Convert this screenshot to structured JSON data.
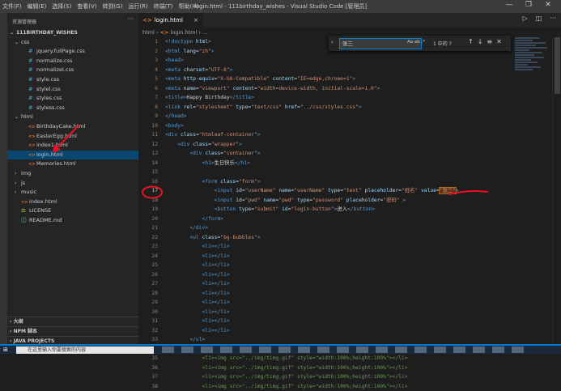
{
  "window": {
    "title": "login.html - 111birthday_wishes - Visual Studio Code [管理员]",
    "menu": [
      "文件(F)",
      "编辑(E)",
      "选择(S)",
      "查看(V)",
      "转到(G)",
      "运行(R)",
      "终端(T)",
      "帮助(H)"
    ],
    "controls": [
      "—",
      "❐",
      "✕"
    ]
  },
  "sidebar": {
    "title": "资源管理器",
    "more": "···",
    "root": "111BIRTHDAY_WISHES",
    "tree": [
      {
        "label": "css",
        "kind": "folder-open",
        "depth": 1
      },
      {
        "label": "jquery.fullPage.css",
        "kind": "css",
        "depth": 2
      },
      {
        "label": "normalize.css",
        "kind": "css",
        "depth": 2
      },
      {
        "label": "normalizel.css",
        "kind": "css",
        "depth": 2
      },
      {
        "label": "style.css",
        "kind": "css",
        "depth": 2
      },
      {
        "label": "stylel.css",
        "kind": "css",
        "depth": 2
      },
      {
        "label": "styles.css",
        "kind": "css",
        "depth": 2
      },
      {
        "label": "styless.css",
        "kind": "css",
        "depth": 2
      },
      {
        "label": "html",
        "kind": "folder-open",
        "depth": 1
      },
      {
        "label": "BirthdayCake.html",
        "kind": "html",
        "depth": 2
      },
      {
        "label": "EasterEgg.html",
        "kind": "html",
        "depth": 2
      },
      {
        "label": "index1.html",
        "kind": "html",
        "depth": 2
      },
      {
        "label": "login.html",
        "kind": "html",
        "depth": 2,
        "selected": true
      },
      {
        "label": "Memories.html",
        "kind": "html",
        "depth": 2
      },
      {
        "label": "img",
        "kind": "folder",
        "depth": 1
      },
      {
        "label": "js",
        "kind": "folder",
        "depth": 1
      },
      {
        "label": "music",
        "kind": "folder",
        "depth": 1
      },
      {
        "label": "index.html",
        "kind": "html",
        "depth": 1
      },
      {
        "label": "LICENSE",
        "kind": "license",
        "depth": 1
      },
      {
        "label": "README.md",
        "kind": "info",
        "depth": 1
      }
    ],
    "sections": [
      "大纲",
      "NPM 脚本",
      "JAVA PROJECTS"
    ]
  },
  "editor": {
    "tab_label": "login.html",
    "tab_close": "×",
    "actions": [
      "▷",
      "◫",
      "···"
    ],
    "breadcrumb": {
      "folder": "html",
      "sep": "›",
      "file": "login.html",
      "tail": "› ..."
    },
    "find": {
      "toggle": "›",
      "query": "张三",
      "options": "Aa  ab  .*",
      "count": "1 中的 ?",
      "up": "↑",
      "down": "↓",
      "sel": "≡",
      "close": "✕"
    },
    "current_line": "17",
    "annotation_color": "#e81123"
  },
  "code_lines": [
    {
      "n": "1",
      "tokens": [
        [
          "tag",
          "<!doctype "
        ],
        [
          "attr",
          "html"
        ],
        [
          "tag",
          ">"
        ]
      ]
    },
    {
      "n": "2",
      "tokens": [
        [
          "tag",
          "<html "
        ],
        [
          "attr",
          "lang"
        ],
        [
          "txt",
          "="
        ],
        [
          "str",
          "\"zh\""
        ],
        [
          "tag",
          ">"
        ]
      ]
    },
    {
      "n": "3",
      "tokens": [
        [
          "tag",
          "<head>"
        ]
      ]
    },
    {
      "n": "4",
      "tokens": [
        [
          "tag",
          "<meta "
        ],
        [
          "attr",
          "charset"
        ],
        [
          "txt",
          "="
        ],
        [
          "str",
          "\"UTF-8\""
        ],
        [
          "tag",
          ">"
        ]
      ]
    },
    {
      "n": "5",
      "tokens": [
        [
          "tag",
          "<meta "
        ],
        [
          "attr",
          "http-equiv"
        ],
        [
          "txt",
          "="
        ],
        [
          "str",
          "\"X-UA-Compatible\""
        ],
        [
          "txt",
          " "
        ],
        [
          "attr",
          "content"
        ],
        [
          "txt",
          "="
        ],
        [
          "str",
          "\"IE=edge,chrome=1\""
        ],
        [
          "tag",
          ">"
        ]
      ]
    },
    {
      "n": "6",
      "tokens": [
        [
          "tag",
          "<meta "
        ],
        [
          "attr",
          "name"
        ],
        [
          "txt",
          "="
        ],
        [
          "str",
          "\"viewport\""
        ],
        [
          "txt",
          " "
        ],
        [
          "attr",
          "content"
        ],
        [
          "txt",
          "="
        ],
        [
          "str",
          "\"width=device-width, initial-scale=1.0\""
        ],
        [
          "tag",
          ">"
        ]
      ]
    },
    {
      "n": "7",
      "tokens": [
        [
          "tag",
          "<title>"
        ],
        [
          "txt",
          "Happy Birthday"
        ],
        [
          "tag",
          "</title>"
        ]
      ]
    },
    {
      "n": "8",
      "tokens": [
        [
          "tag",
          "<link "
        ],
        [
          "attr",
          "rel"
        ],
        [
          "txt",
          "="
        ],
        [
          "str",
          "\"stylesheet\""
        ],
        [
          "txt",
          " "
        ],
        [
          "attr",
          "type"
        ],
        [
          "txt",
          "="
        ],
        [
          "str",
          "\"text/css\""
        ],
        [
          "txt",
          " "
        ],
        [
          "attr",
          "href"
        ],
        [
          "txt",
          "="
        ],
        [
          "str",
          "\"../css/styles.css\""
        ],
        [
          "tag",
          ">"
        ]
      ]
    },
    {
      "n": "9",
      "tokens": [
        [
          "tag",
          "</head>"
        ]
      ]
    },
    {
      "n": "10",
      "tokens": [
        [
          "tag",
          "<body>"
        ]
      ]
    },
    {
      "n": "11",
      "tokens": [
        [
          "tag",
          "<div "
        ],
        [
          "attr",
          "class"
        ],
        [
          "txt",
          "="
        ],
        [
          "str",
          "\"htmleaf-container\""
        ],
        [
          "tag",
          ">"
        ]
      ]
    },
    {
      "n": "12",
      "tokens": [
        [
          "txt",
          "    "
        ],
        [
          "tag",
          "<div "
        ],
        [
          "attr",
          "class"
        ],
        [
          "txt",
          "="
        ],
        [
          "str",
          "\"wrapper\""
        ],
        [
          "tag",
          ">"
        ]
      ]
    },
    {
      "n": "13",
      "tokens": [
        [
          "txt",
          "        "
        ],
        [
          "tag",
          "<div "
        ],
        [
          "attr",
          "class"
        ],
        [
          "txt",
          "="
        ],
        [
          "str",
          "\"container\""
        ],
        [
          "tag",
          ">"
        ]
      ]
    },
    {
      "n": "14",
      "tokens": [
        [
          "txt",
          "            "
        ],
        [
          "tag",
          "<h1>"
        ],
        [
          "txt",
          "生日快乐"
        ],
        [
          "tag",
          "</h1>"
        ]
      ]
    },
    {
      "n": "15",
      "tokens": []
    },
    {
      "n": "16",
      "tokens": [
        [
          "txt",
          "            "
        ],
        [
          "tag",
          "<form "
        ],
        [
          "attr",
          "class"
        ],
        [
          "txt",
          "="
        ],
        [
          "str",
          "\"form\""
        ],
        [
          "tag",
          ">"
        ]
      ]
    },
    {
      "n": "17",
      "tokens": [
        [
          "txt",
          "                "
        ],
        [
          "tag",
          "<input "
        ],
        [
          "attr",
          "id"
        ],
        [
          "txt",
          "="
        ],
        [
          "str",
          "\"userName\""
        ],
        [
          "txt",
          " "
        ],
        [
          "attr",
          "name"
        ],
        [
          "txt",
          "="
        ],
        [
          "str",
          "\"userName\""
        ],
        [
          "txt",
          " "
        ],
        [
          "attr",
          "type"
        ],
        [
          "txt",
          "="
        ],
        [
          "str",
          "\"text\""
        ],
        [
          "txt",
          " "
        ],
        [
          "attr",
          "placeholder"
        ],
        [
          "txt",
          "="
        ],
        [
          "str",
          "\"姓名\""
        ],
        [
          "txt",
          " "
        ],
        [
          "attr",
          "value"
        ],
        [
          "txt",
          "="
        ],
        [
          "hl",
          "\"张三\""
        ],
        [
          "tag",
          ">"
        ]
      ]
    },
    {
      "n": "18",
      "tokens": [
        [
          "txt",
          "                "
        ],
        [
          "tag",
          "<input "
        ],
        [
          "attr",
          "id"
        ],
        [
          "txt",
          "="
        ],
        [
          "str",
          "\"pwd\""
        ],
        [
          "txt",
          " "
        ],
        [
          "attr",
          "name"
        ],
        [
          "txt",
          "="
        ],
        [
          "str",
          "\"pwd\""
        ],
        [
          "txt",
          " "
        ],
        [
          "attr",
          "type"
        ],
        [
          "txt",
          "="
        ],
        [
          "str",
          "\"password\""
        ],
        [
          "txt",
          " "
        ],
        [
          "attr",
          "placeholder"
        ],
        [
          "txt",
          "="
        ],
        [
          "str",
          "\"密码\""
        ],
        [
          "txt",
          " "
        ],
        [
          "tag",
          ">"
        ]
      ]
    },
    {
      "n": "19",
      "tokens": [
        [
          "txt",
          "                "
        ],
        [
          "tag",
          "<button "
        ],
        [
          "attr",
          "type"
        ],
        [
          "txt",
          "="
        ],
        [
          "str",
          "\"submit\""
        ],
        [
          "txt",
          " "
        ],
        [
          "attr",
          "id"
        ],
        [
          "txt",
          "="
        ],
        [
          "str",
          "\"login-button\""
        ],
        [
          "tag",
          ">"
        ],
        [
          "txt",
          "进入"
        ],
        [
          "tag",
          "</button>"
        ]
      ]
    },
    {
      "n": "20",
      "tokens": [
        [
          "txt",
          "            "
        ],
        [
          "tag",
          "</form>"
        ]
      ]
    },
    {
      "n": "21",
      "tokens": [
        [
          "txt",
          "        "
        ],
        [
          "tag",
          "</div>"
        ]
      ]
    },
    {
      "n": "22",
      "tokens": [
        [
          "txt",
          "        "
        ],
        [
          "tag",
          "<ul "
        ],
        [
          "attr",
          "class"
        ],
        [
          "txt",
          "="
        ],
        [
          "str",
          "\"bg-bubbles\""
        ],
        [
          "tag",
          ">"
        ]
      ]
    },
    {
      "n": "23",
      "tokens": [
        [
          "txt",
          "            "
        ],
        [
          "tag",
          "<li></li>"
        ]
      ]
    },
    {
      "n": "24",
      "tokens": [
        [
          "txt",
          "            "
        ],
        [
          "tag",
          "<li></li>"
        ]
      ]
    },
    {
      "n": "25",
      "tokens": [
        [
          "txt",
          "            "
        ],
        [
          "tag",
          "<li></li>"
        ]
      ]
    },
    {
      "n": "26",
      "tokens": [
        [
          "txt",
          "            "
        ],
        [
          "tag",
          "<li></li>"
        ]
      ]
    },
    {
      "n": "27",
      "tokens": [
        [
          "txt",
          "            "
        ],
        [
          "tag",
          "<li></li>"
        ]
      ]
    },
    {
      "n": "28",
      "tokens": [
        [
          "txt",
          "            "
        ],
        [
          "tag",
          "<li></li>"
        ]
      ]
    },
    {
      "n": "29",
      "tokens": [
        [
          "txt",
          "            "
        ],
        [
          "tag",
          "<li></li>"
        ]
      ]
    },
    {
      "n": "30",
      "tokens": [
        [
          "txt",
          "            "
        ],
        [
          "tag",
          "<li></li>"
        ]
      ]
    },
    {
      "n": "31",
      "tokens": [
        [
          "txt",
          "            "
        ],
        [
          "tag",
          "<li></li>"
        ]
      ]
    },
    {
      "n": "32",
      "tokens": [
        [
          "txt",
          "            "
        ],
        [
          "tag",
          "<li></li>"
        ]
      ]
    },
    {
      "n": "33",
      "tokens": [
        [
          "txt",
          "        "
        ],
        [
          "tag",
          "</ul>"
        ]
      ]
    },
    {
      "n": "34",
      "tokens": [
        [
          "txt",
          "        "
        ],
        [
          "com",
          "<!-- <ul class=\"bg-bubbles\">"
        ]
      ]
    },
    {
      "n": "35",
      "tokens": [
        [
          "txt",
          "            "
        ],
        [
          "com",
          "<li><img src=\"../img/timg.gif\" style=\"width:100%;height:100%\"></li>"
        ]
      ]
    },
    {
      "n": "36",
      "tokens": [
        [
          "txt",
          "            "
        ],
        [
          "com",
          "<li><img src=\"../img/timg.gif\" style=\"width:100%;height:100%\"></li>"
        ]
      ]
    },
    {
      "n": "37",
      "tokens": [
        [
          "txt",
          "            "
        ],
        [
          "com",
          "<li><img src=\"../img/timg.gif\" style=\"width:100%;height:100%\"></li>"
        ]
      ]
    },
    {
      "n": "38",
      "tokens": [
        [
          "txt",
          "            "
        ],
        [
          "com",
          "<li><img src=\"../img/timg.gif\" style=\"width:100%;height:100%\"></li>"
        ]
      ]
    }
  ],
  "taskbar": {
    "start": "⊞",
    "search_placeholder": "在这里输入你要搜索的内容"
  }
}
